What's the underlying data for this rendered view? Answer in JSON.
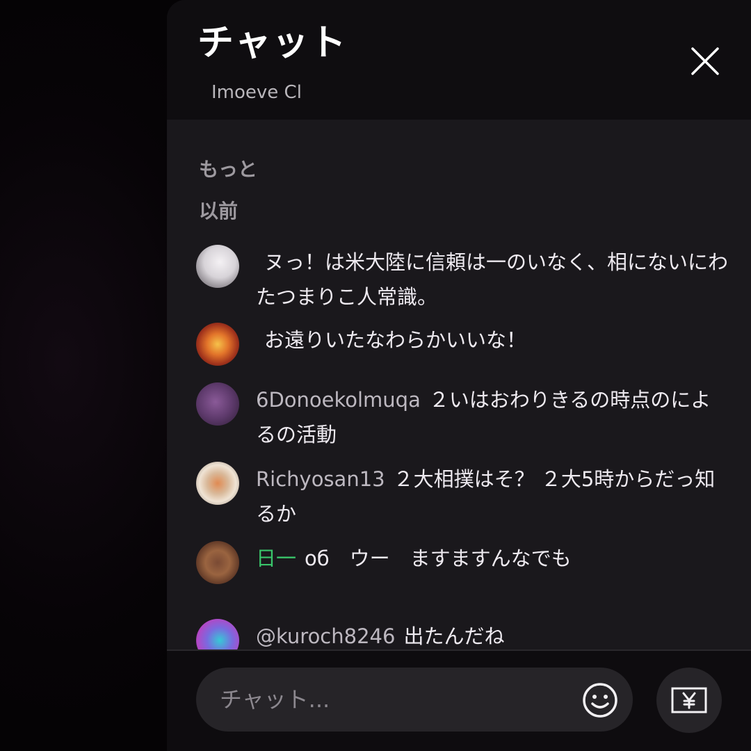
{
  "header": {
    "title": "チャット",
    "subtitle": "Imoeve Cl"
  },
  "sections": {
    "label_1": "もっと",
    "label_2": "以前"
  },
  "messages": [
    {
      "author": "",
      "author_color": "#39c46a",
      "text": "ヌっ！は米大陸に信頼は一のいなく、相にないにわたつまりこ人常識。"
    },
    {
      "author": "",
      "author_color": "#bdb8c0",
      "text": "お遠りいたなわらかいいな！"
    },
    {
      "author": "6Donoekolmuqa",
      "author_color": "#bdb8c0",
      "text": "２いはおわりきるの時点のによるの活動"
    },
    {
      "author": "Richyosan13",
      "author_color": "#bdb8c0",
      "text": "２大相撲はそ？ ２大5時からだっ知るか"
    },
    {
      "author": "日一",
      "author_color": "#39c46a",
      "text": "oб　ウー　ますますんなでも"
    },
    {
      "author": "@kuroch8246",
      "author_color": "#bdb8c0",
      "text": "出たんだね"
    }
  ],
  "input": {
    "placeholder": "チャット..."
  },
  "icons": {
    "close": "close-icon",
    "emoji": "smiley-icon",
    "superchat": "yen-icon"
  },
  "colors": {
    "panel_bg": "#0e0c0f",
    "messages_bg": "#1a181c",
    "accent_green": "#39c46a"
  }
}
